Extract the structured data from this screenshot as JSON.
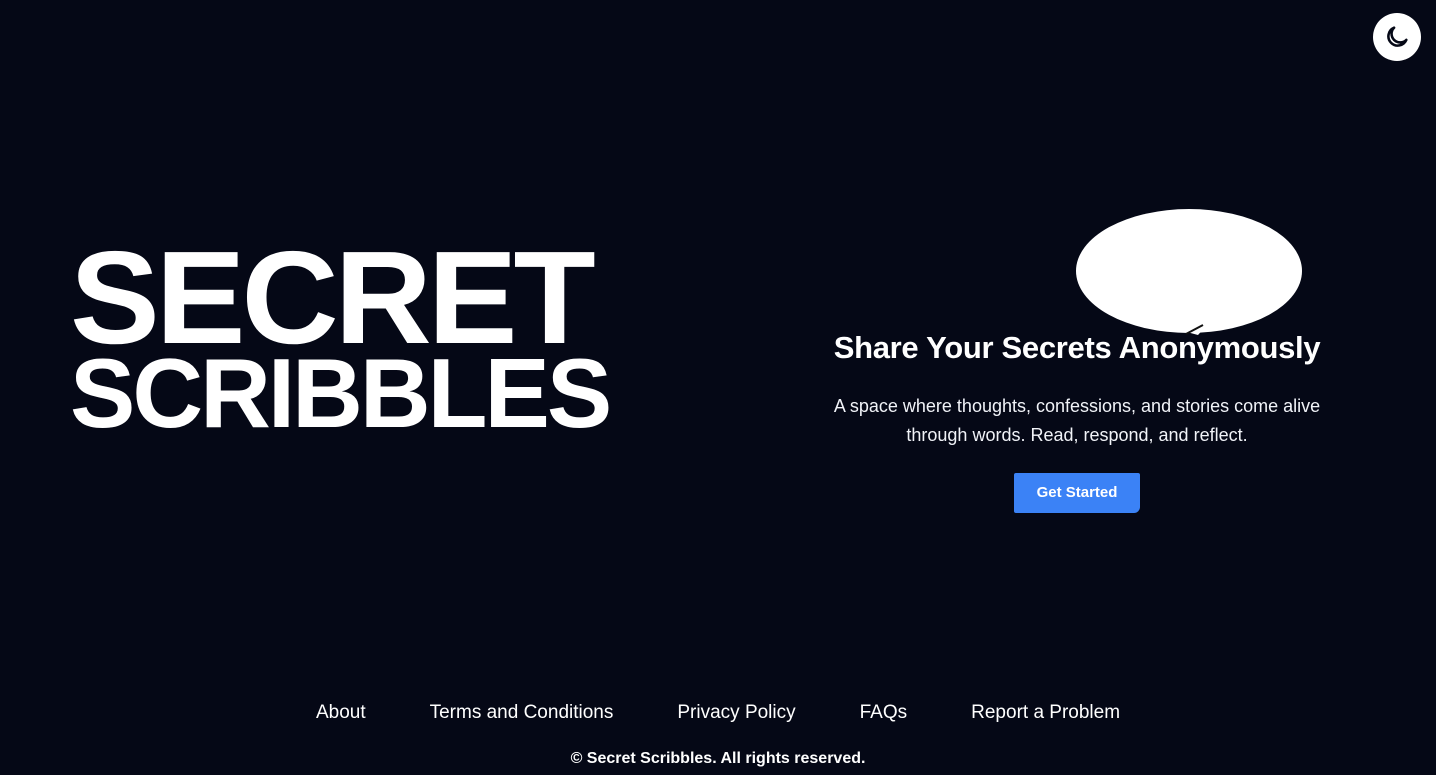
{
  "theme_toggle": {
    "icon": "moon-icon"
  },
  "logo": {
    "line1": "SECRET",
    "line2": "SCRIBBLES"
  },
  "hero": {
    "title": "Share Your Secrets Anonymously",
    "description": "A space where thoughts, confessions, and stories come alive through words. Read, respond, and reflect.",
    "cta_label": "Get Started",
    "bubble_icon": "speech-bubble-icon"
  },
  "footer": {
    "links": [
      "About",
      "Terms and Conditions",
      "Privacy Policy",
      "FAQs",
      "Report a Problem"
    ],
    "copyright": "© Secret Scribbles. All rights reserved."
  },
  "colors": {
    "background": "#050816",
    "text": "#ffffff",
    "accent": "#3b82f6"
  }
}
